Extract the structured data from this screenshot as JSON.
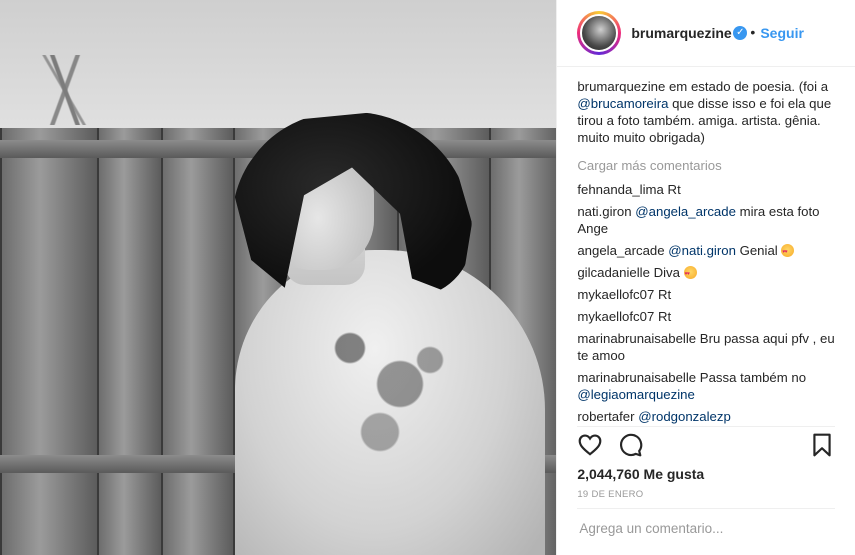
{
  "post": {
    "username": "brumarquezine",
    "follow_label": "Seguir",
    "separator": "•",
    "verified_glyph": "✓"
  },
  "caption": {
    "username": "brumarquezine",
    "text_1": " em estado de poesia. (foi a ",
    "mention": "@brucamoreira",
    "text_2": " que disse isso e foi ela que tirou a foto também. amiga. artista. gênia. muito muito obrigada)"
  },
  "load_more_label": "Cargar más comentarios",
  "comments": [
    {
      "user": "fehnanda_lima",
      "text": " Rt"
    },
    {
      "user": "nati.giron",
      "mention": "@angela_arcade",
      "text": " mira esta foto Ange"
    },
    {
      "user": "angela_arcade",
      "mention": "@nati.giron",
      "text": " Genial ",
      "emoji": "heart-eyes-emoji"
    },
    {
      "user": "gilcadanielle",
      "text": " Diva ",
      "emoji": "heart-eyes-emoji"
    },
    {
      "user": "mykaellofc07",
      "text": " Rt"
    },
    {
      "user": "mykaellofc07",
      "text": " Rt"
    },
    {
      "user": "marinabrunaisabelle",
      "text": " Bru passa aqui pfv , eu te amoo"
    },
    {
      "user": "marinabrunaisabelle",
      "text": " Passa também no ",
      "mention_after": "@legiaomarquezine"
    },
    {
      "user": "robertafer",
      "mention": "@rodgonzalezp",
      "text": ""
    }
  ],
  "likes": {
    "count": "2,044,760",
    "label": " Me gusta"
  },
  "date": "19 DE ENERO",
  "add_comment_placeholder": "Agrega un comentario...",
  "icons": [
    "heart-icon",
    "comment-icon",
    "bookmark-icon",
    "verified-icon"
  ],
  "colors": {
    "link": "#3897f0",
    "mention": "#003569",
    "muted": "#999999"
  }
}
